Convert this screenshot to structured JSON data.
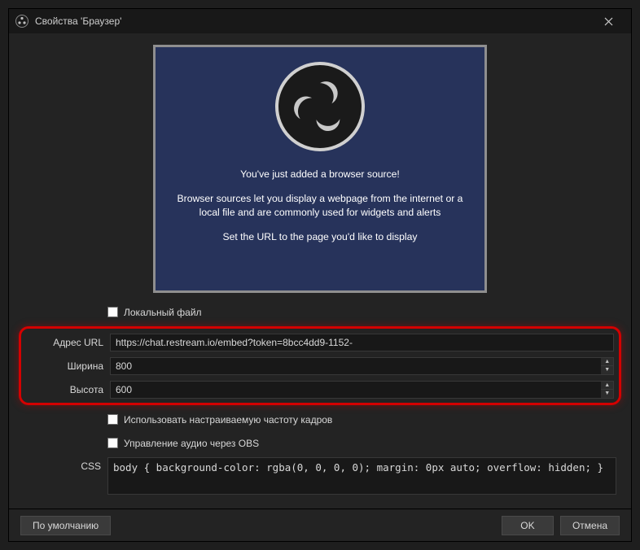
{
  "window": {
    "title": "Свойства 'Браузер'"
  },
  "preview": {
    "line1": "You've just added a browser source!",
    "line2": "Browser sources let you display a webpage from the internet or a local file and are commonly used for widgets and alerts",
    "line3": "Set the URL to the page you'd like to display"
  },
  "form": {
    "local_file_label": "Локальный файл",
    "url_label": "Адрес URL",
    "url_value": "https://chat.restream.io/embed?token=8bcc4dd9-1152-",
    "width_label": "Ширина",
    "width_value": "800",
    "height_label": "Высота",
    "height_value": "600",
    "custom_fps_label": "Использовать настраиваемую частоту кадров",
    "audio_obs_label": "Управление аудио через OBS",
    "css_label": "CSS",
    "css_value": "body { background-color: rgba(0, 0, 0, 0); margin: 0px auto; overflow: hidden; }"
  },
  "footer": {
    "defaults": "По умолчанию",
    "ok": "OK",
    "cancel": "Отмена"
  }
}
